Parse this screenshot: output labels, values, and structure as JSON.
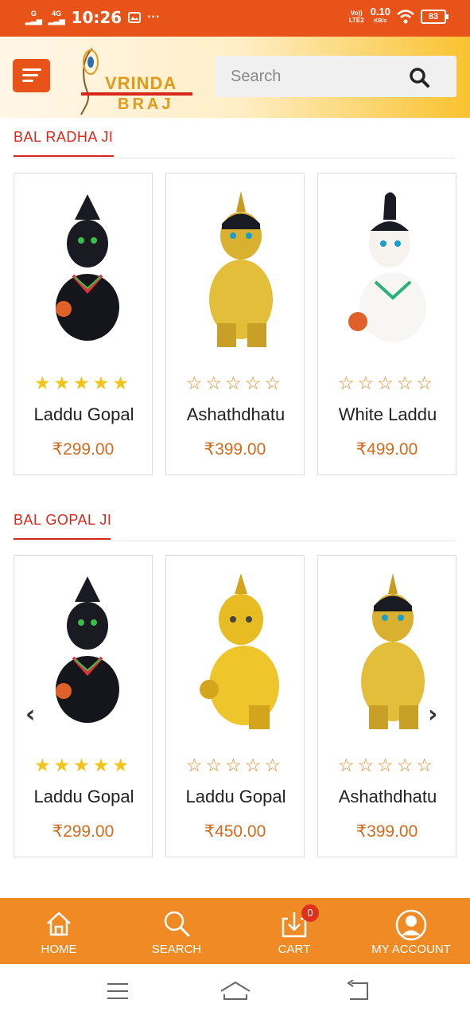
{
  "status_bar": {
    "signal1": "G",
    "signal2": "4G",
    "time": "10:26",
    "volte": "Vo))",
    "lte": "LTE2",
    "speed": "0.10",
    "speed_unit": "KB/s",
    "battery": "83"
  },
  "header": {
    "logo_line1": "VRINDA",
    "logo_line2": "BRAJ",
    "search_placeholder": "Search"
  },
  "sections": [
    {
      "title": "BAL RADHA JI",
      "products": [
        {
          "name": "Laddu Gopal",
          "price": "₹299.00",
          "stars": "★★★★★",
          "rated": true
        },
        {
          "name": "Ashathdhatu",
          "price": "₹399.00",
          "stars": "☆☆☆☆☆",
          "rated": false
        },
        {
          "name": "White Laddu",
          "price": "₹499.00",
          "stars": "☆☆☆☆☆",
          "rated": false
        }
      ]
    },
    {
      "title": "BAL GOPAL JI",
      "products": [
        {
          "name": "Laddu Gopal",
          "price": "₹299.00",
          "stars": "★★★★★",
          "rated": true
        },
        {
          "name": "Laddu Gopal",
          "price": "₹450.00",
          "stars": "☆☆☆☆☆",
          "rated": false
        },
        {
          "name": "Ashathdhatu",
          "price": "₹399.00",
          "stars": "☆☆☆☆☆",
          "rated": false
        }
      ]
    }
  ],
  "carousel": {
    "prev": "‹",
    "next": "›"
  },
  "bottom_nav": {
    "home": "HOME",
    "search": "SEARCH",
    "cart": "CART",
    "cart_count": "0",
    "account": "MY ACCOUNT"
  },
  "colors": {
    "brand": "#e8531a",
    "nav": "#ef8a25",
    "accent_red": "#d8271b",
    "price": "#d26b1c",
    "star_filled": "#f0c419"
  },
  "icons": [
    "menu-icon",
    "search-icon",
    "home-icon",
    "cart-icon",
    "account-icon",
    "chevron-left-icon",
    "chevron-right-icon"
  ]
}
